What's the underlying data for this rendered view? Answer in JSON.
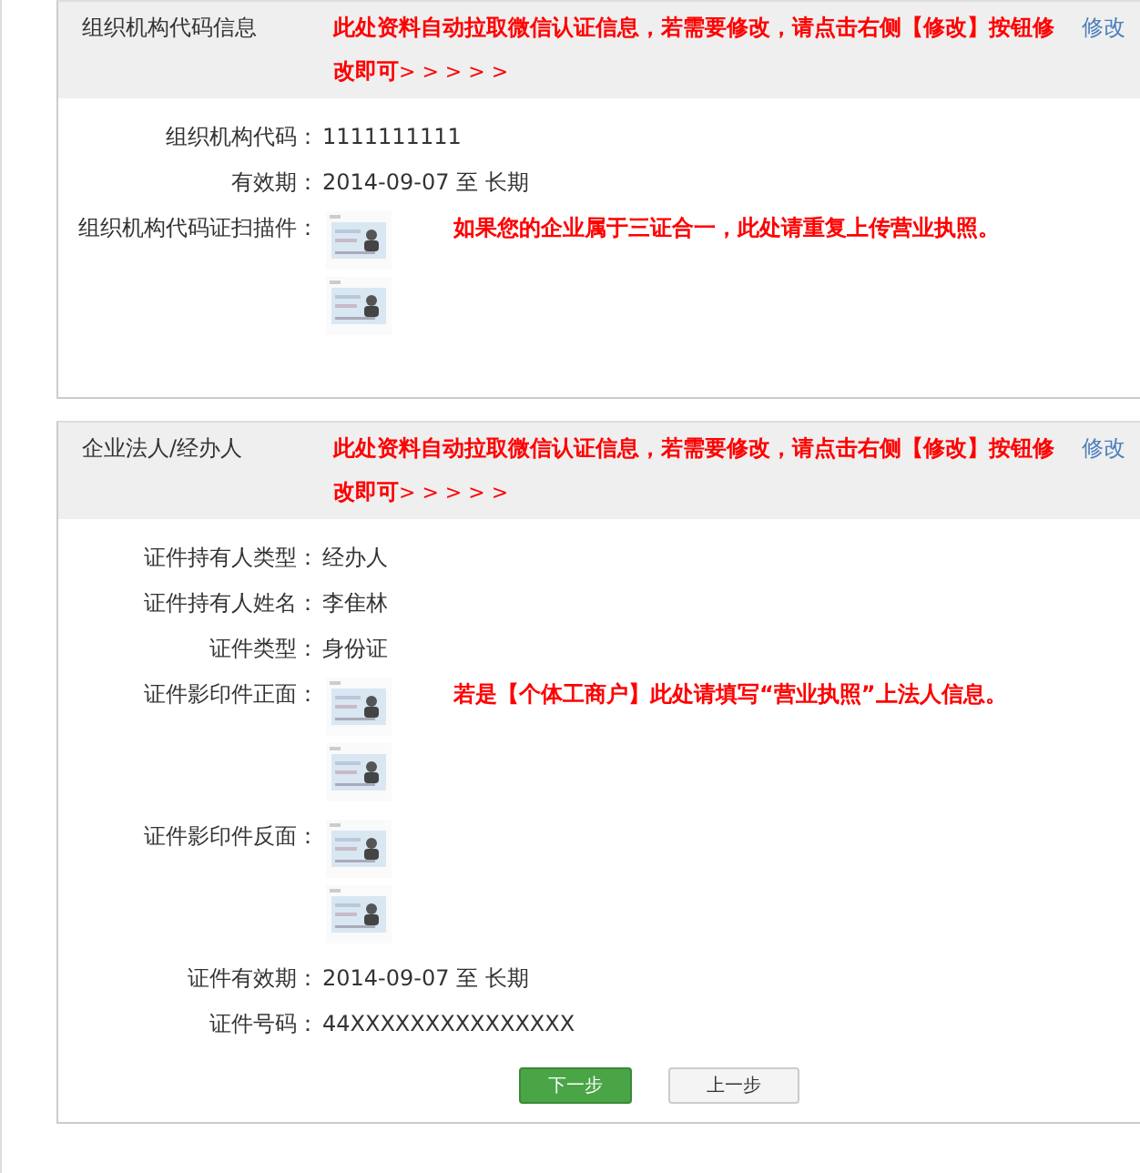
{
  "sections": [
    {
      "title": "组织机构代码信息",
      "notice": "此处资料自动拉取微信认证信息，若需要修改，请点击右侧【修改】按钮修改即可",
      "arrows": "> > > > >",
      "edit_link": "修改",
      "rows": [
        {
          "kind": "text",
          "label": "组织机构代码：",
          "value": "1111111111"
        },
        {
          "kind": "text",
          "label": "有效期：",
          "value": "2014-09-07 至 长期"
        },
        {
          "kind": "images",
          "label": "组织机构代码证扫描件：",
          "hint": "如果您的企业属于三证合一，此处请重复上传营业执照。"
        }
      ]
    },
    {
      "title": "企业法人/经办人",
      "notice": "此处资料自动拉取微信认证信息，若需要修改，请点击右侧【修改】按钮修改即可",
      "arrows": "> > > > >",
      "edit_link": "修改",
      "rows": [
        {
          "kind": "text",
          "label": "证件持有人类型：",
          "value": "经办人"
        },
        {
          "kind": "text",
          "label": "证件持有人姓名：",
          "value": "李隹林"
        },
        {
          "kind": "text",
          "label": "证件类型：",
          "value": "身份证"
        },
        {
          "kind": "images",
          "label": "证件影印件正面：",
          "hint": "若是【个体工商户】此处请填写“营业执照”上法人信息。"
        },
        {
          "kind": "images",
          "label": "证件影印件反面："
        },
        {
          "kind": "text",
          "label": "证件有效期：",
          "value": "2014-09-07 至 长期"
        },
        {
          "kind": "text",
          "label": "证件号码：",
          "value": "44XXXXXXXXXXXXXXX"
        }
      ]
    }
  ],
  "buttons": [
    {
      "kind": "primary",
      "label": "下一步"
    },
    {
      "kind": "secondary",
      "label": "上一步"
    }
  ]
}
